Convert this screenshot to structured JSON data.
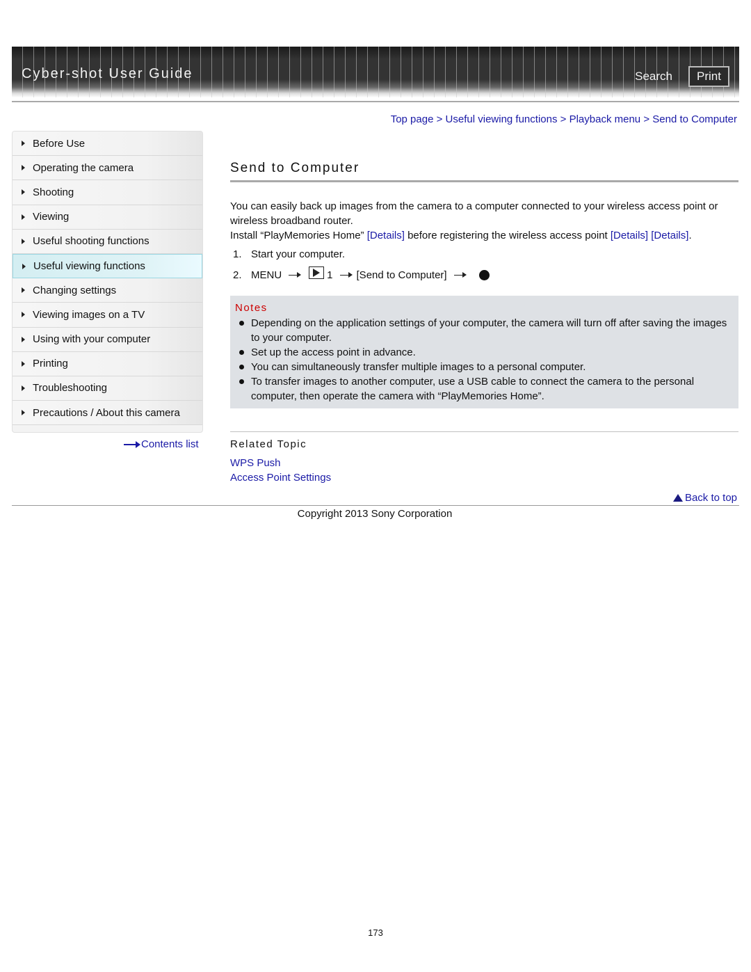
{
  "header": {
    "title": "Cyber-shot User Guide",
    "search_label": "Search",
    "print_label": "Print"
  },
  "breadcrumb": {
    "items": [
      "Top page",
      "Useful viewing functions",
      "Playback menu",
      "Send to Computer"
    ],
    "separator": ">"
  },
  "sidebar": {
    "items": [
      {
        "label": "Before Use"
      },
      {
        "label": "Operating the camera"
      },
      {
        "label": "Shooting"
      },
      {
        "label": "Viewing"
      },
      {
        "label": "Useful shooting functions"
      },
      {
        "label": "Useful viewing functions",
        "active": true
      },
      {
        "label": "Changing settings"
      },
      {
        "label": "Viewing images on a TV"
      },
      {
        "label": "Using with your computer"
      },
      {
        "label": "Printing"
      },
      {
        "label": "Troubleshooting"
      },
      {
        "label": "Precautions / About this camera"
      }
    ],
    "contents_link": "Contents list"
  },
  "main": {
    "title": "Send to Computer",
    "intro_line1": "You can easily back up images from the camera to a computer connected to your wireless access point or wireless broadband router.",
    "intro_line2_a": "Install “PlayMemories Home” ",
    "intro_link1": "[Details]",
    "intro_line2_b": " before registering the wireless access point ",
    "intro_link2": "[Details]",
    "intro_link3": "[Details]",
    "intro_line2_end": ".",
    "steps": [
      {
        "num": "1.",
        "text": "Start your computer."
      },
      {
        "num": "2.",
        "menu": "MENU",
        "tab_number": "1",
        "item": "[Send to Computer]"
      }
    ],
    "notes": {
      "title": "Notes",
      "items": [
        "Depending on the application settings of your computer, the camera will turn off after saving the images to your computer.",
        "Set up the access point in advance.",
        "You can simultaneously transfer multiple images to a personal computer.",
        "To transfer images to another computer, use a USB cable to connect the camera to the personal computer, then operate the camera with “PlayMemories Home”."
      ]
    },
    "related": {
      "title": "Related Topic",
      "links": [
        "WPS Push",
        "Access Point Settings"
      ]
    }
  },
  "footer": {
    "back_to_top": "Back to top",
    "copyright": "Copyright 2013 Sony Corporation",
    "page_number": "173"
  },
  "colors": {
    "link": "#1a1aa6",
    "notes_title": "#cc0000",
    "notes_bg": "#dee1e5",
    "active_item_bg": "#dff3f6"
  }
}
